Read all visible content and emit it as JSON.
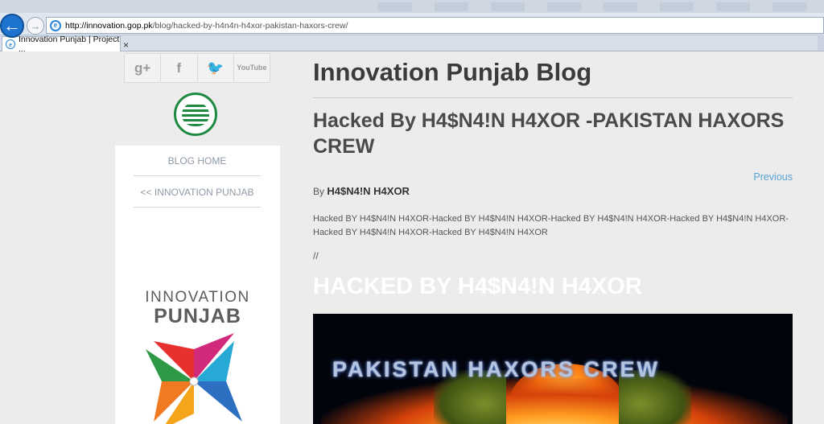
{
  "browser": {
    "url_host": "http://innovation.gop.pk",
    "url_path": "/blog/hacked-by-h4n4n-h4xor-pakistan-haxors-crew/",
    "tab_title": "Innovation Punjab | Project ...",
    "tab_close": "×"
  },
  "social": {
    "googleplus": "g+",
    "facebook": "f",
    "twitter": "🐦",
    "youtube_line1": "You",
    "youtube_line2": "Tube"
  },
  "sidebar": {
    "home_label": "BLOG HOME",
    "innovation_label": "<< INNOVATION PUNJAB",
    "logo_line1": "INNOVATION",
    "logo_line2": "PUNJAB"
  },
  "content": {
    "blog_title": "Innovation Punjab Blog",
    "post_title": "Hacked By H4$N4!N H4XOR -PAKISTAN HAXORS CREW",
    "previous_label": "Previous",
    "by_label": "By",
    "author": "H4$N4!N H4XOR",
    "post_text": "Hacked BY H4$N4!N H4XOR-Hacked BY H4$N4!N H4XOR-Hacked BY H4$N4!N H4XOR-Hacked BY H4$N4!N H4XOR-Hacked BY H4$N4!N H4XOR-Hacked BY H4$N4!N H4XOR",
    "slashes": "//",
    "hacked_heading": "HACKED BY H4$N4!N H4XOR",
    "banner_text": "PAKISTAN HAXORS CREW"
  },
  "colors": {
    "accent_link": "#5aa3d6",
    "emblem_green": "#1d8a3f",
    "back_button": "#1e73cf"
  }
}
